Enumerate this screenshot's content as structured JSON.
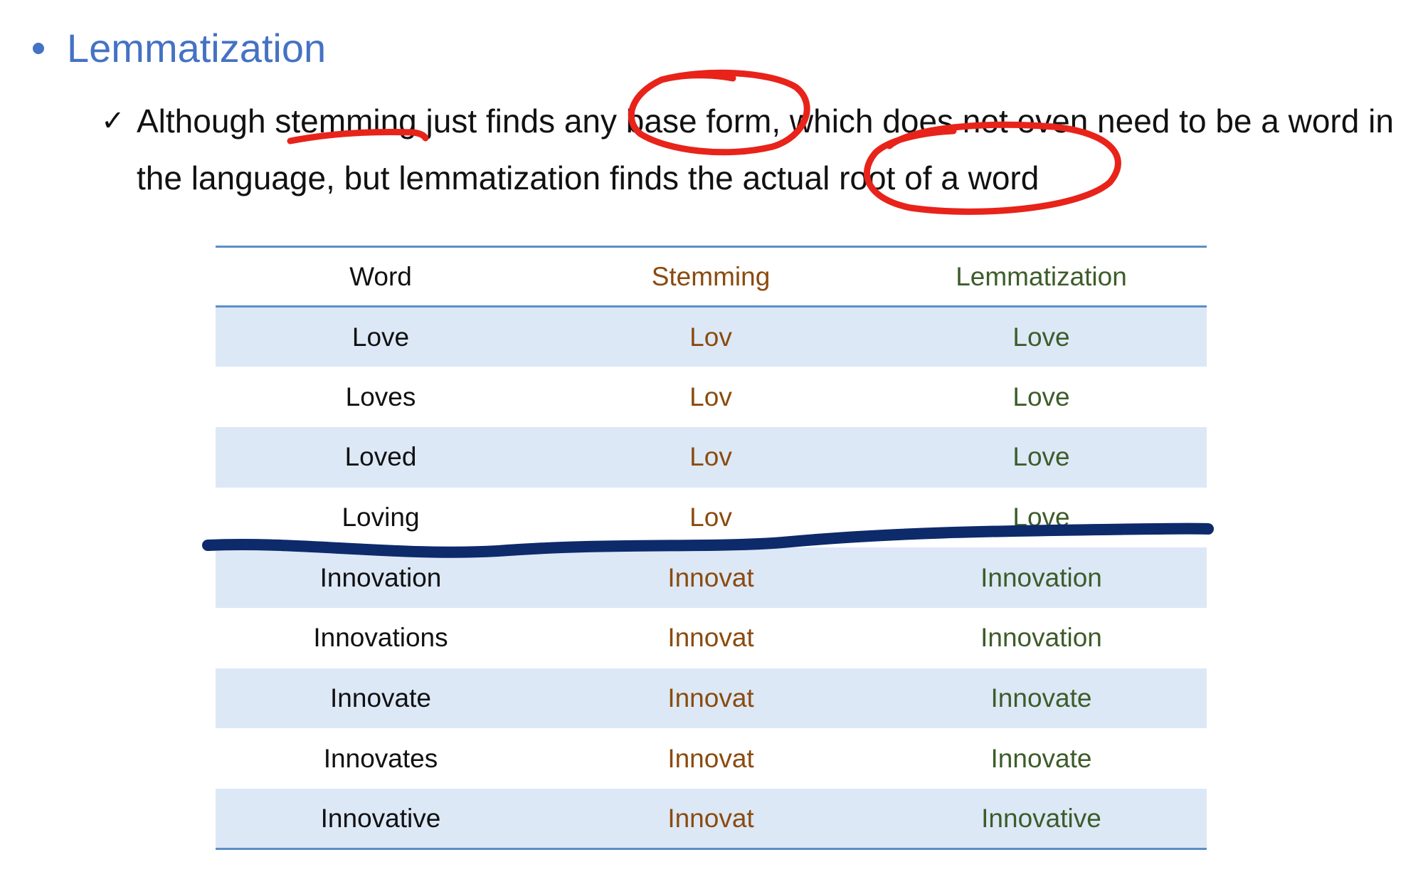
{
  "heading": {
    "text": "Lemmatization"
  },
  "point": {
    "checkmark": "✓",
    "text": "Although stemming just finds any base form, which does not even need to be a word in the language, but lemmatization finds the actual root of a word"
  },
  "table": {
    "headers": {
      "word": "Word",
      "stemming": "Stemming",
      "lemmatization": "Lemmatization"
    },
    "rows": [
      {
        "word": "Love",
        "stem": "Lov",
        "lemma": "Love"
      },
      {
        "word": "Loves",
        "stem": "Lov",
        "lemma": "Love"
      },
      {
        "word": "Loved",
        "stem": "Lov",
        "lemma": "Love"
      },
      {
        "word": "Loving",
        "stem": "Lov",
        "lemma": "Love"
      },
      {
        "word": "Innovation",
        "stem": "Innovat",
        "lemma": "Innovation"
      },
      {
        "word": "Innovations",
        "stem": "Innovat",
        "lemma": "Innovation"
      },
      {
        "word": "Innovate",
        "stem": "Innovat",
        "lemma": "Innovate"
      },
      {
        "word": "Innovates",
        "stem": "Innovat",
        "lemma": "Innovate"
      },
      {
        "word": "Innovative",
        "stem": "Innovat",
        "lemma": "Innovative"
      }
    ]
  },
  "colors": {
    "heading": "#4472c4",
    "stemming": "#8a4b0f",
    "lemmatization": "#3d5c2a",
    "row_band": "#dce8f6",
    "rule": "#5b8fc7",
    "red_ink": "#e8231a",
    "blue_ink": "#0d2a6b"
  }
}
